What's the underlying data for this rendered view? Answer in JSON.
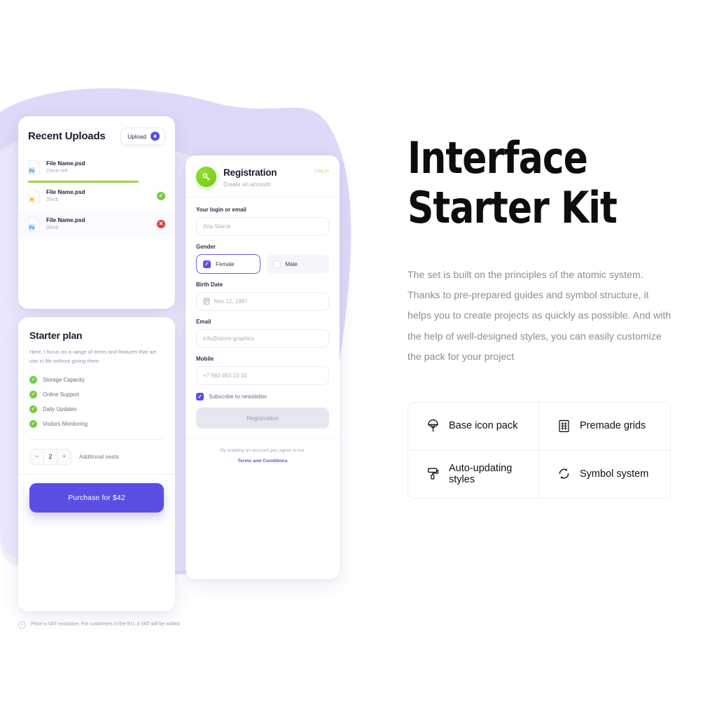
{
  "theme": {
    "accent_purple": "#5B4EE5",
    "blob_purple": "#D9D4F7",
    "success_green": "#7AC943",
    "avatar_green": "#7ED321",
    "error_red": "#E23B3B",
    "progress_green": "#9FD441",
    "login_link_green": "#C6D98A"
  },
  "uploads": {
    "title": "Recent Uploads",
    "upload_button_label": "Upload",
    "files": [
      {
        "name": "File Name.psd",
        "sub": "23min left",
        "icon": "photoshop-file-icon",
        "badge": "ps",
        "status": "uploading",
        "progress": 72
      },
      {
        "name": "File Name.psd",
        "sub": "35mb",
        "icon": "sketch-file-icon",
        "badge": "sk",
        "status": "success",
        "status_glyph": "✓"
      },
      {
        "name": "File Name.psd",
        "sub": "35mb",
        "icon": "photoshop-file-icon",
        "badge": "ps",
        "status": "error",
        "status_glyph": "✕"
      }
    ]
  },
  "plan": {
    "title": "Starter plan",
    "description": "Here, I focus on a range of items and features that we use in life without giving them",
    "features": [
      {
        "label": "Storage Capacity",
        "check": "✓"
      },
      {
        "label": "Online Support",
        "check": "✓"
      },
      {
        "label": "Daily Updates",
        "check": "✓"
      },
      {
        "label": "Visitors Monitoring",
        "check": "✓"
      }
    ],
    "seats": {
      "minus": "−",
      "value": "2",
      "plus": "+",
      "label": "Additional seats"
    },
    "purchase_label": "Purchase for $42",
    "vat_note": "Price is VAT exclusive. For customers in the EU, a VAT will be added"
  },
  "registration": {
    "title": "Registration",
    "subtitle": "Create an account",
    "login_link": "Log in",
    "fields": {
      "login": {
        "label": "Your login or email",
        "placeholder": "Aria Starck"
      },
      "gender": {
        "label": "Gender",
        "options": [
          {
            "label": "Female",
            "selected": true,
            "check": "✓"
          },
          {
            "label": "Male",
            "selected": false
          }
        ]
      },
      "birth": {
        "label": "Birth Date",
        "placeholder": "Nov 12, 1987",
        "icon": "calendar-icon"
      },
      "email": {
        "label": "Email",
        "placeholder": "info@istore.graphics"
      },
      "mobile": {
        "label": "Mobile",
        "placeholder": "+7 583 463 23 34"
      }
    },
    "newsletter": {
      "label": "Subscribe to newsletter",
      "checked": true,
      "check": "✓"
    },
    "submit_label": "Registration",
    "footer_text": "By creating an account you agree to our",
    "footer_link": "Terms and Conditions"
  },
  "right": {
    "title_line1": "Interface",
    "title_line2": "Starter Kit",
    "paragraph": "The set is built on the principles of the atomic system. Thanks to pre-prepared guides and symbol structure, it helps you to create projects as quickly as possible. And with the help of well-designed styles, you can easily customize the pack for your project",
    "features": [
      {
        "label": "Base icon pack",
        "icon": "parachute-icon"
      },
      {
        "label": "Premade grids",
        "icon": "grid-icon"
      },
      {
        "label": "Auto-updating styles",
        "icon": "paint-roller-icon"
      },
      {
        "label": "Symbol system",
        "icon": "sync-icon"
      }
    ]
  }
}
